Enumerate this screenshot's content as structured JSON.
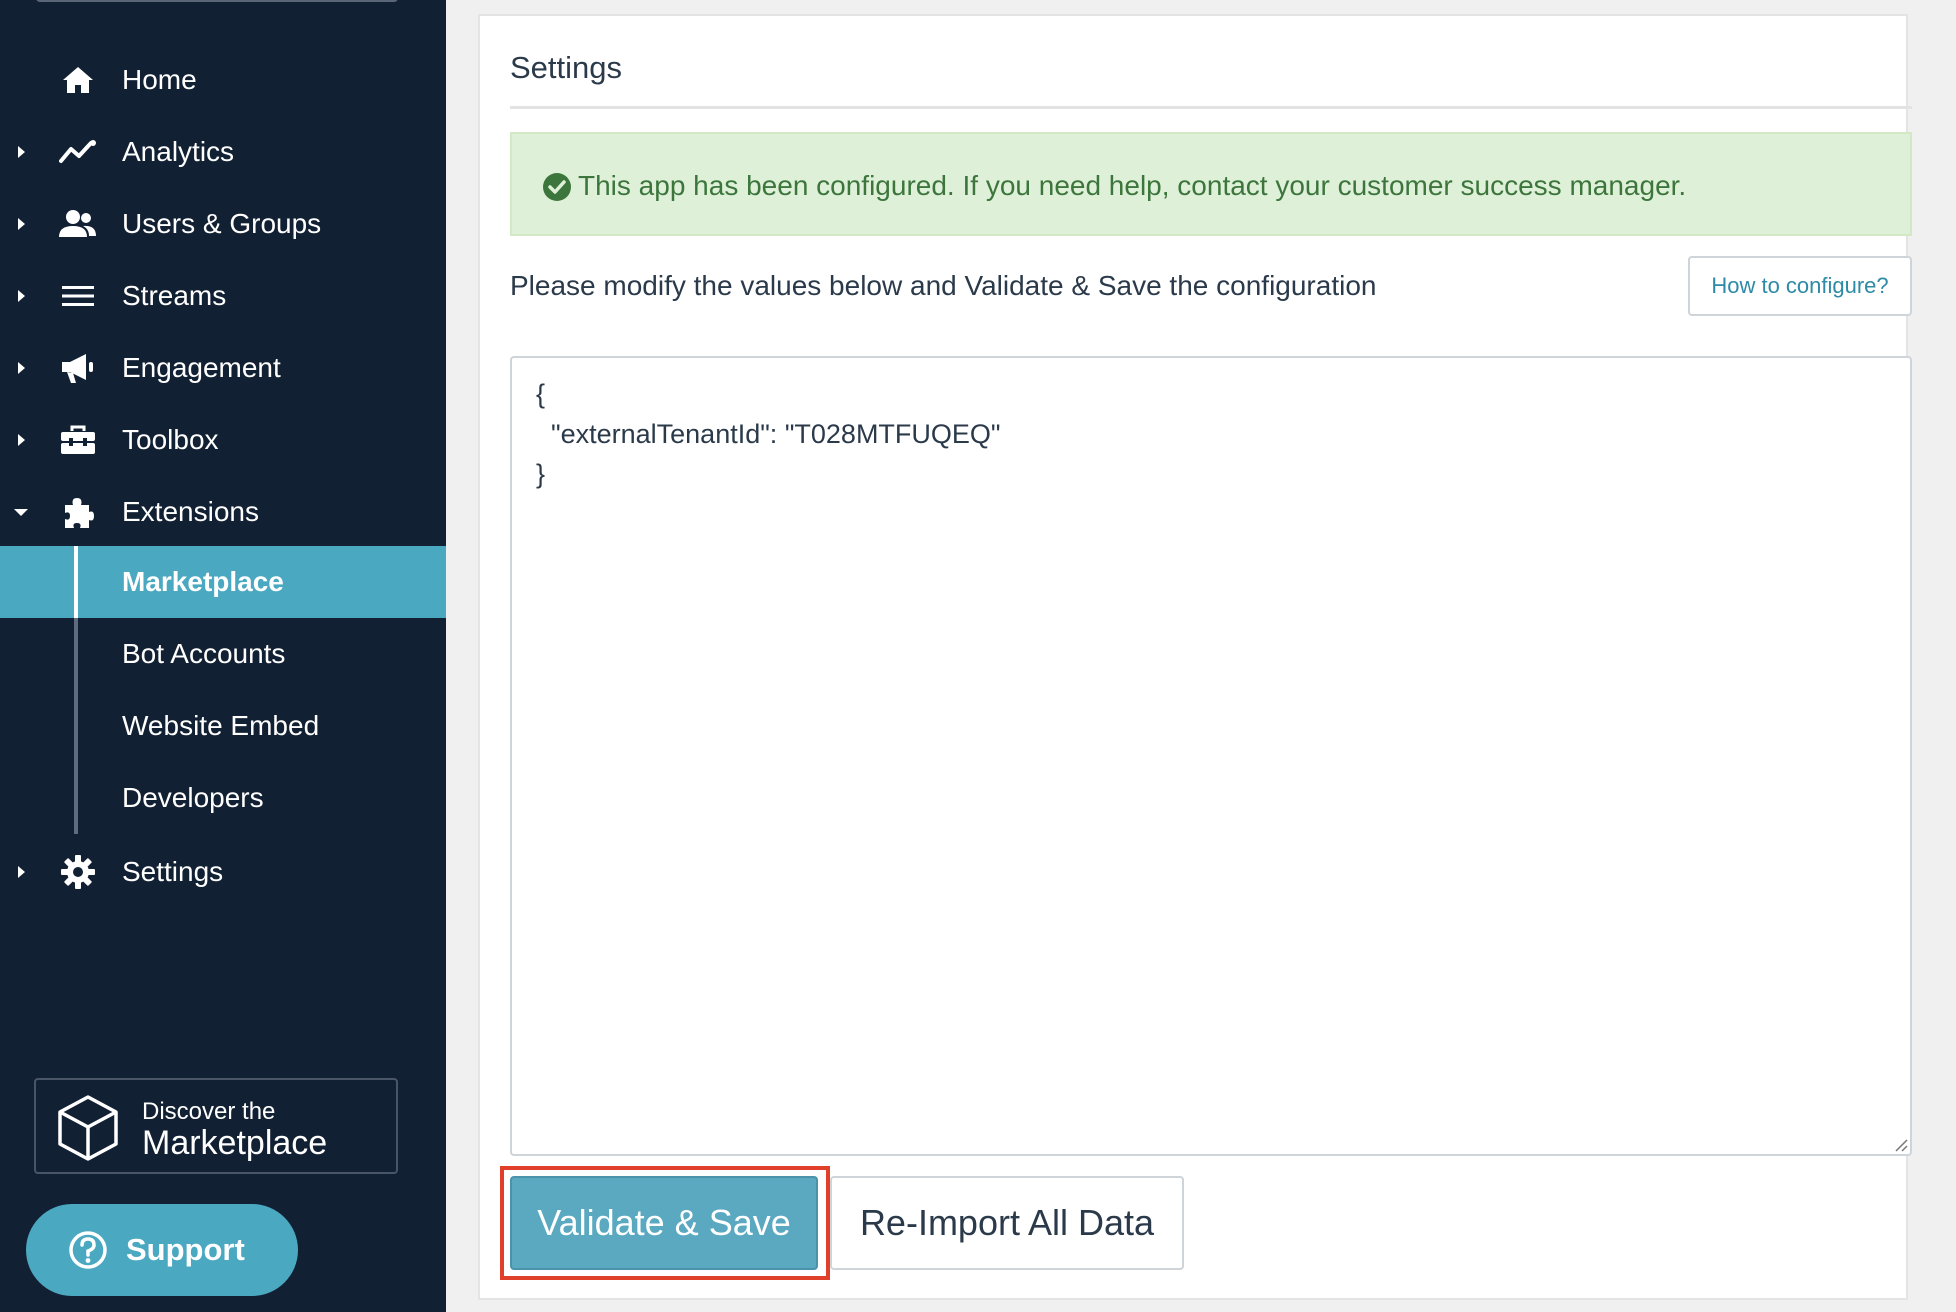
{
  "sidebar": {
    "items": [
      {
        "label": "Home",
        "icon": "home-icon"
      },
      {
        "label": "Analytics",
        "icon": "analytics-icon"
      },
      {
        "label": "Users & Groups",
        "icon": "users-icon"
      },
      {
        "label": "Streams",
        "icon": "streams-icon"
      },
      {
        "label": "Engagement",
        "icon": "megaphone-icon"
      },
      {
        "label": "Toolbox",
        "icon": "toolbox-icon"
      },
      {
        "label": "Extensions",
        "icon": "puzzle-icon"
      },
      {
        "label": "Settings",
        "icon": "gear-icon"
      }
    ],
    "extensions_children": [
      {
        "label": "Marketplace",
        "active": true
      },
      {
        "label": "Bot Accounts",
        "active": false
      },
      {
        "label": "Website Embed",
        "active": false
      },
      {
        "label": "Developers",
        "active": false
      }
    ],
    "discover": {
      "line1": "Discover the",
      "line2": "Marketplace"
    },
    "support_label": "Support"
  },
  "main": {
    "title": "Settings",
    "alert_text": "This app has been configured. If you need help, contact your customer success manager.",
    "instructions": "Please modify the values below and Validate & Save the configuration",
    "howto_label": "How to configure?",
    "config_value": "{\n  \"externalTenantId\": \"T028MTFUQEQ\"\n}",
    "validate_label": "Validate & Save",
    "reimport_label": "Re-Import All Data"
  },
  "colors": {
    "sidebar_bg": "#122033",
    "accent": "#4ba8c1",
    "alert_bg": "#dff0d8",
    "alert_text": "#3c763d",
    "highlight": "#e0402a"
  }
}
